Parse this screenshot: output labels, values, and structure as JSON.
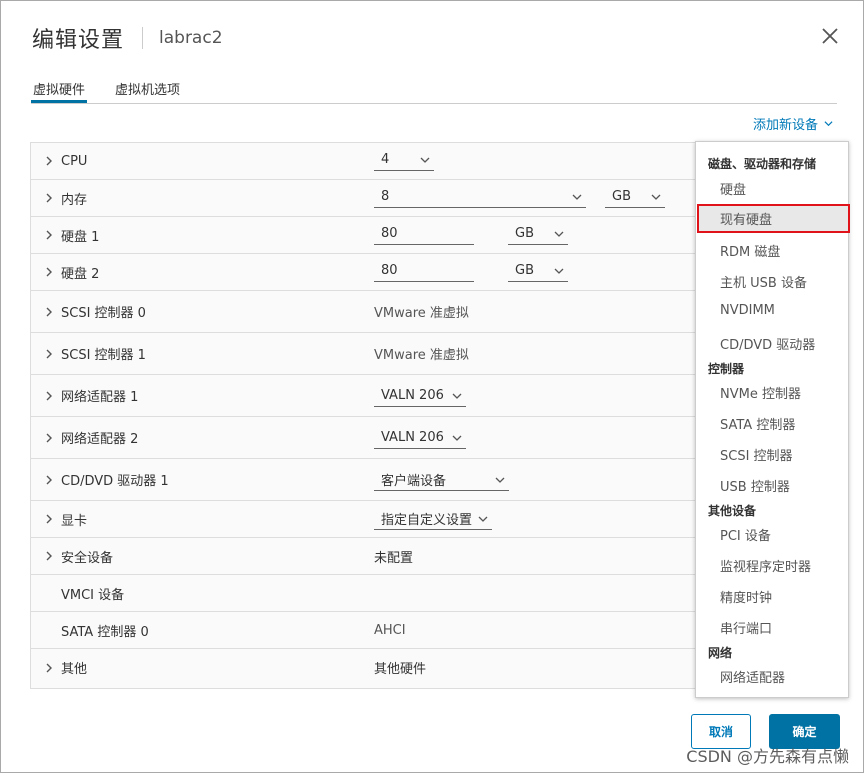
{
  "dialog": {
    "title": "编辑设置",
    "subtitle": "labrac2"
  },
  "tabs": [
    {
      "label": "虚拟硬件",
      "active": true
    },
    {
      "label": "虚拟机选项",
      "active": false
    }
  ],
  "add_device": "添加新设备",
  "rows": {
    "cpu": {
      "label": "CPU",
      "value": "4"
    },
    "memory": {
      "label": "内存",
      "value": "8",
      "unit": "GB"
    },
    "disk1": {
      "label": "硬盘 1",
      "value": "80",
      "unit": "GB"
    },
    "disk2": {
      "label": "硬盘 2",
      "value": "80",
      "unit": "GB"
    },
    "scsi0": {
      "label": "SCSI 控制器 0",
      "value": "VMware 准虚拟"
    },
    "scsi1": {
      "label": "SCSI 控制器 1",
      "value": "VMware 准虚拟"
    },
    "net1": {
      "label": "网络适配器 1",
      "value": "VALN 206"
    },
    "net2": {
      "label": "网络适配器 2",
      "value": "VALN 206"
    },
    "cddvd1": {
      "label": "CD/DVD 驱动器 1",
      "value": "客户端设备"
    },
    "video": {
      "label": "显卡",
      "value": "指定自定义设置"
    },
    "security": {
      "label": "安全设备",
      "value": "未配置"
    },
    "vmci": {
      "label": "VMCI 设备",
      "value": ""
    },
    "sata0": {
      "label": "SATA 控制器 0",
      "value": "AHCI"
    },
    "other": {
      "label": "其他",
      "value": "其他硬件"
    }
  },
  "menu": {
    "groups": {
      "disks": "磁盘、驱动器和存储",
      "controllers": "控制器",
      "other_devices": "其他设备",
      "network": "网络"
    },
    "items": {
      "hard_disk": "硬盘",
      "existing_disk": "现有硬盘",
      "rdm_disk": "RDM 磁盘",
      "host_usb": "主机 USB 设备",
      "nvdimm": "NVDIMM",
      "cddvd_drive": "CD/DVD 驱动器",
      "nvme": "NVMe 控制器",
      "sata": "SATA 控制器",
      "scsi": "SCSI 控制器",
      "usb": "USB 控制器",
      "pci": "PCI 设备",
      "watchdog": "监视程序定时器",
      "precision_clock": "精度时钟",
      "serial_port": "串行端口",
      "network_adapter": "网络适配器"
    }
  },
  "buttons": {
    "cancel": "取消",
    "ok": "确定"
  },
  "watermark": "CSDN @方先森有点懒",
  "colors": {
    "accent": "#0072a3",
    "link": "#0079b8",
    "highlight_border": "#e0131a"
  }
}
